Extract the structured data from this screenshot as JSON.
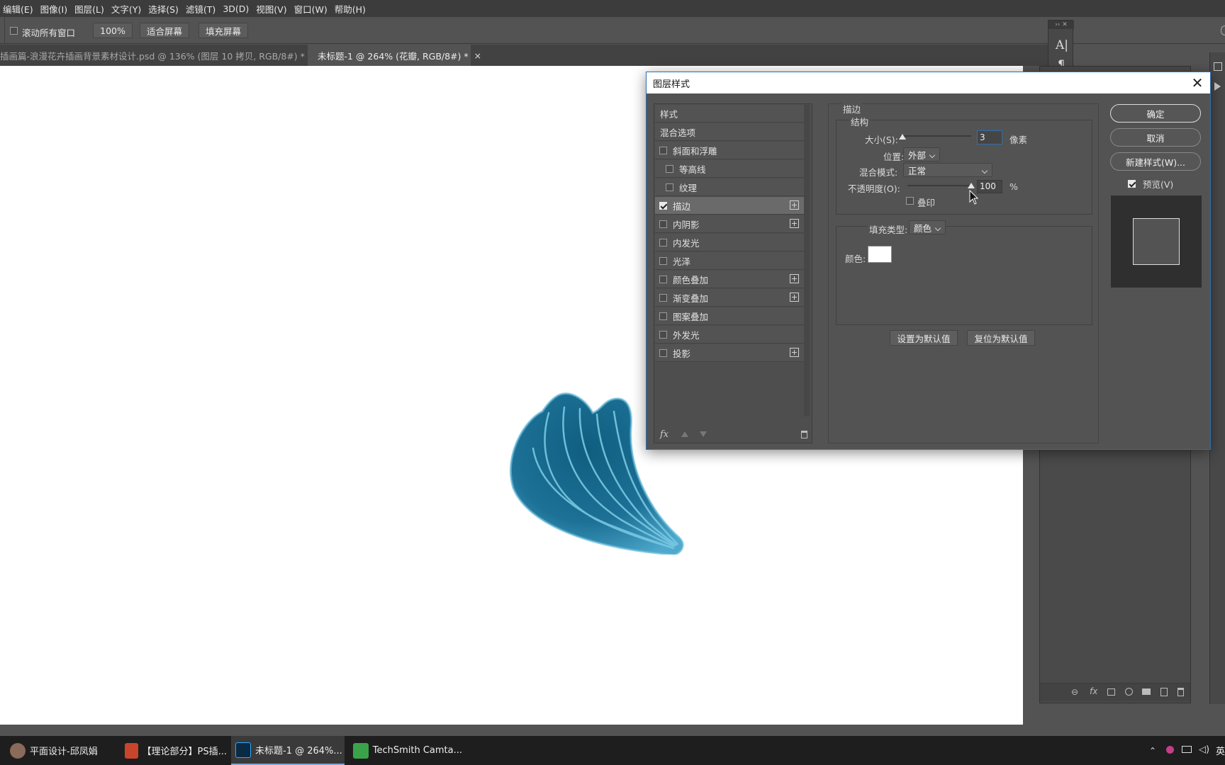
{
  "menu": [
    "编辑(E)",
    "图像(I)",
    "图层(L)",
    "文字(Y)",
    "选择(S)",
    "滤镜(T)",
    "3D(D)",
    "视图(V)",
    "窗口(W)",
    "帮助(H)"
  ],
  "options_bar": {
    "scroll_all_label": "滚动所有窗口",
    "zoom_value": "100%",
    "fit_screen_label": "适合屏幕",
    "fill_screen_label": "填充屏幕"
  },
  "tabs": [
    {
      "title": "插画篇-浪漫花卉插画背景素材设计.psd @ 136% (图层 10 拷贝, RGB/8#) *",
      "close": "×"
    },
    {
      "title": "未标题-1 @ 264% (花瓣, RGB/8#) *",
      "close": "×"
    }
  ],
  "colors": {
    "accent": "#2d6fb3",
    "petal": "#1d6f8f",
    "petal_light": "#5fb6d6"
  },
  "dialog": {
    "title": "图层样式",
    "close": "✕",
    "styles_header": "样式",
    "blend_options": "混合选项",
    "items": [
      {
        "label": "斜面和浮雕",
        "checked": false,
        "plus": false,
        "indent": false
      },
      {
        "label": "等高线",
        "checked": false,
        "plus": false,
        "indent": true
      },
      {
        "label": "纹理",
        "checked": false,
        "plus": false,
        "indent": true
      },
      {
        "label": "描边",
        "checked": true,
        "plus": true,
        "indent": false
      },
      {
        "label": "内阴影",
        "checked": false,
        "plus": true,
        "indent": false
      },
      {
        "label": "内发光",
        "checked": false,
        "plus": false,
        "indent": false
      },
      {
        "label": "光泽",
        "checked": false,
        "plus": false,
        "indent": false
      },
      {
        "label": "颜色叠加",
        "checked": false,
        "plus": true,
        "indent": false
      },
      {
        "label": "渐变叠加",
        "checked": false,
        "plus": true,
        "indent": false
      },
      {
        "label": "图案叠加",
        "checked": false,
        "plus": false,
        "indent": false
      },
      {
        "label": "外发光",
        "checked": false,
        "plus": false,
        "indent": false
      },
      {
        "label": "投影",
        "checked": false,
        "plus": true,
        "indent": false
      }
    ],
    "fx_label": "fx",
    "stroke": {
      "section_title": "描边",
      "structure_title": "结构",
      "size_label": "大小(S):",
      "size_value": "3",
      "size_unit": "像素",
      "position_label": "位置:",
      "position_value": "外部",
      "blend_mode_label": "混合模式:",
      "blend_mode_value": "正常",
      "opacity_label": "不透明度(O):",
      "opacity_value": "100",
      "opacity_unit": "%",
      "overprint_label": "叠印",
      "fill_type_label": "填充类型:",
      "fill_type_value": "颜色",
      "color_label": "颜色:",
      "color_value": "#ffffff",
      "set_default": "设置为默认值",
      "reset_default": "复位为默认值"
    },
    "buttons": {
      "ok": "确定",
      "cancel": "取消",
      "new_style": "新建样式(W)...",
      "preview": "预览(V)"
    }
  },
  "taskbar": [
    {
      "label": "平面设计-邱凤娟",
      "icon": "avatar-icon"
    },
    {
      "label": "【理论部分】PS插...",
      "icon": "powerpoint-icon"
    },
    {
      "label": "未标题-1 @ 264%...",
      "icon": "photoshop-icon"
    },
    {
      "label": "TechSmith Camta...",
      "icon": "camtasia-icon"
    }
  ],
  "tray_lang": "英"
}
